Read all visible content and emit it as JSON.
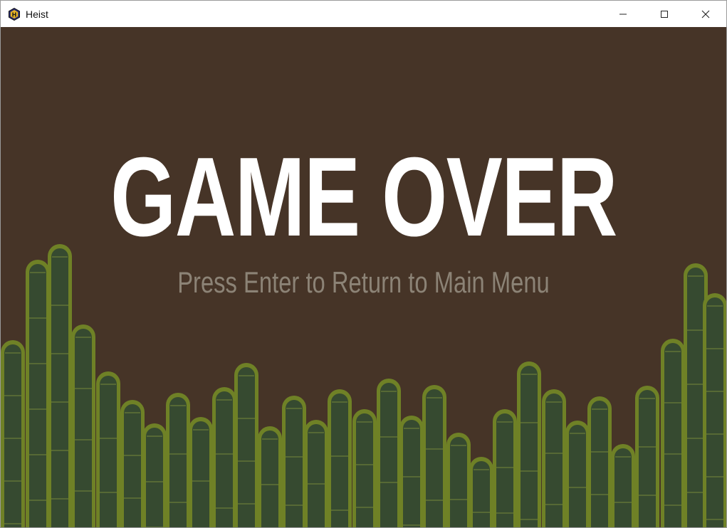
{
  "window": {
    "title": "Heist",
    "app_icon": "hexagon-h-icon",
    "controls": [
      "minimize-icon",
      "maximize-icon",
      "close-icon"
    ]
  },
  "game": {
    "title": "GAME OVER",
    "subtitle": "Press Enter to Return to Main Menu"
  },
  "colors": {
    "background": "#463427",
    "title": "#ffffff",
    "subtitle": "#8c8376",
    "bamboo_rim": "#6f8126",
    "bamboo_fill": "#364a30",
    "bamboo_node": "#6a7c38"
  }
}
